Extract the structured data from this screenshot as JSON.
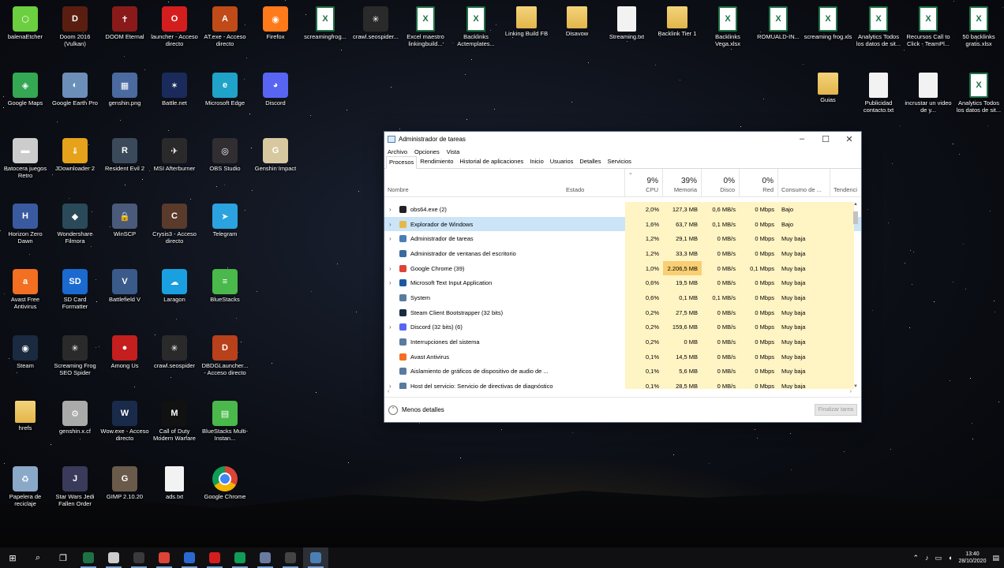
{
  "desktop_icons": [
    {
      "label": "balenaEtcher",
      "color": "#6bcf3f",
      "glyph": "⬡"
    },
    {
      "label": "Doom 2016 (Vulkan)",
      "color": "#5a1e10",
      "glyph": "D"
    },
    {
      "label": "DOOM Eternal",
      "color": "#8a1a1a",
      "glyph": "✝"
    },
    {
      "label": "launcher - Acceso directo",
      "color": "#d41e1e",
      "glyph": "O"
    },
    {
      "label": "AT.exe - Acceso directo",
      "color": "#c04a18",
      "glyph": "A"
    },
    {
      "label": "Firefox",
      "color": "#ff7a1a",
      "glyph": "◉"
    },
    {
      "label": "screamingfrog...",
      "type": "xl"
    },
    {
      "label": "crawl.seospider...",
      "color": "#2a2a2a",
      "glyph": "✳"
    },
    {
      "label": "Excel maestro linkingbuild...",
      "type": "xl"
    },
    {
      "label": "Backlinks Actemplates...",
      "type": "xl"
    },
    {
      "label": "Linking Build FB",
      "type": "folder"
    },
    {
      "label": "Disavow",
      "type": "folder"
    },
    {
      "label": "Streaming.txt",
      "type": "txt"
    },
    {
      "label": "Backlink Tier 1",
      "type": "folder"
    },
    {
      "label": "Backlinks Vega.xlsx",
      "type": "xl"
    },
    {
      "label": "ROMUALD-IN...",
      "type": "xl"
    },
    {
      "label": "screaming frog.xls",
      "type": "xl"
    },
    {
      "label": "Analytics Todos los datos de sit...",
      "type": "xl"
    },
    {
      "label": "Recursos Call to Click - TeamPl...",
      "type": "xl"
    },
    {
      "label": "50 backlinks gratis.xlsx",
      "type": "xl"
    },
    {
      "label": "Google Maps",
      "color": "#34a853",
      "glyph": "◈"
    },
    {
      "label": "Google Earth Pro",
      "color": "#6b8fb8",
      "glyph": "◐"
    },
    {
      "label": "genshin.png",
      "color": "#4a6aa0",
      "glyph": "▦"
    },
    {
      "label": "Battle.net",
      "color": "#1a2a5a",
      "glyph": "✶"
    },
    {
      "label": "Microsoft Edge",
      "color": "#1fa3c9",
      "glyph": "e"
    },
    {
      "label": "Discord",
      "color": "#5865f2",
      "glyph": "◕"
    },
    {
      "label": "Guias",
      "type": "folder"
    },
    {
      "label": "Publicidad contacto.txt",
      "type": "txt"
    },
    {
      "label": "incrustar un video de y...",
      "type": "txt"
    },
    {
      "label": "Analytics Todos los datos de sit...",
      "type": "xl"
    },
    {
      "label": "Batocera juegos Retro",
      "color": "#cccccc",
      "glyph": "▬"
    },
    {
      "label": "JDownloader 2",
      "color": "#e6a21a",
      "glyph": "⇓"
    },
    {
      "label": "Resident Evil 2",
      "color": "#3a4a5a",
      "glyph": "R"
    },
    {
      "label": "MSI Afterburner",
      "color": "#2a2a2a",
      "glyph": "✈"
    },
    {
      "label": "OBS Studio",
      "color": "#302e31",
      "glyph": "◎"
    },
    {
      "label": "Genshin Impact",
      "color": "#d8c8a0",
      "glyph": "G"
    },
    {
      "label": "Horizon Zero Dawn",
      "color": "#3a5aa0",
      "glyph": "H"
    },
    {
      "label": "Wondershare Filmora",
      "color": "#2a4a5a",
      "glyph": "◆"
    },
    {
      "label": "WinSCP",
      "color": "#4a5a7a",
      "glyph": "🔒"
    },
    {
      "label": "Crysis3 - Acceso directo",
      "color": "#5a3a2a",
      "glyph": "C"
    },
    {
      "label": "Telegram",
      "color": "#2aa3e0",
      "glyph": "➤"
    },
    {
      "label": "Avast Free Antivirus",
      "color": "#f36f21",
      "glyph": "a"
    },
    {
      "label": "SD Card Formatter",
      "color": "#1a6ad0",
      "glyph": "SD"
    },
    {
      "label": "Battlefield V",
      "color": "#3a5a8a",
      "glyph": "V"
    },
    {
      "label": "Laragon",
      "color": "#1aa0e0",
      "glyph": "☁"
    },
    {
      "label": "BlueStacks",
      "color": "#4ab84a",
      "glyph": "≡"
    },
    {
      "label": "Steam",
      "color": "#1a2a40",
      "glyph": "◉"
    },
    {
      "label": "Screaming Frog SEO Spider",
      "color": "#2a2a2a",
      "glyph": "✳"
    },
    {
      "label": "Among Us",
      "color": "#c41e1e",
      "glyph": "●"
    },
    {
      "label": "crawl.seospider",
      "color": "#2a2a2a",
      "glyph": "✳"
    },
    {
      "label": "DBDGLauncher... - Acceso directo",
      "color": "#b8401a",
      "glyph": "D"
    },
    {
      "label": "hrefs",
      "type": "folder"
    },
    {
      "label": "genshin.x.cf",
      "color": "#aaaaaa",
      "glyph": "⚙"
    },
    {
      "label": "Wow.exe - Acceso directo",
      "color": "#1a2a4a",
      "glyph": "W"
    },
    {
      "label": "Call of Duty Modern Warfare",
      "color": "#111111",
      "glyph": "M"
    },
    {
      "label": "BlueStacks Multi-Instan...",
      "color": "#4ab84a",
      "glyph": "▤"
    },
    {
      "label": "Papelera de reciclaje",
      "color": "#8aa8c8",
      "glyph": "♻"
    },
    {
      "label": "Star Wars Jedi Fallen Order",
      "color": "#3a3a5a",
      "glyph": "J"
    },
    {
      "label": "GIMP 2.10.20",
      "color": "#6a5a4a",
      "glyph": "G"
    },
    {
      "label": "ads.txt",
      "type": "txt"
    },
    {
      "label": "Google Chrome",
      "type": "chrome"
    }
  ],
  "task_manager": {
    "title": "Administrador de tareas",
    "menu": [
      "Archivo",
      "Opciones",
      "Vista"
    ],
    "tabs": [
      "Procesos",
      "Rendimiento",
      "Historial de aplicaciones",
      "Inicio",
      "Usuarios",
      "Detalles",
      "Servicios"
    ],
    "columns": {
      "name": "Nombre",
      "status": "Estado",
      "cpu": {
        "pct": "9%",
        "label": "CPU"
      },
      "mem": {
        "pct": "39%",
        "label": "Memoria"
      },
      "disk": {
        "pct": "0%",
        "label": "Disco"
      },
      "net": {
        "pct": "0%",
        "label": "Red"
      },
      "power": "Consumo de ...",
      "trend": "Tendenci"
    },
    "processes": [
      {
        "name": "obs64.exe (2)",
        "exp": "›",
        "icon": "#222222",
        "cpu": "2,0%",
        "mem": "127,3 MB",
        "disk": "0,6 MB/s",
        "net": "0 Mbps",
        "power": "Bajo"
      },
      {
        "name": "Explorador de Windows",
        "exp": "›",
        "icon": "#e6b84a",
        "cpu": "1,6%",
        "mem": "63,7 MB",
        "disk": "0,1 MB/s",
        "net": "0 Mbps",
        "power": "Bajo"
      },
      {
        "name": "Administrador de tareas",
        "exp": "›",
        "icon": "#4a7fb5",
        "cpu": "1,2%",
        "mem": "29,1 MB",
        "disk": "0 MB/s",
        "net": "0 Mbps",
        "power": "Muy baja"
      },
      {
        "name": "Administrador de ventanas del escritorio",
        "exp": "",
        "icon": "#3a6aa0",
        "cpu": "1,2%",
        "mem": "33,3 MB",
        "disk": "0 MB/s",
        "net": "0 Mbps",
        "power": "Muy baja"
      },
      {
        "name": "Google Chrome (39)",
        "exp": "›",
        "icon": "#db4437",
        "cpu": "1,0%",
        "mem": "2.206,5 MB",
        "disk": "0 MB/s",
        "net": "0,1 Mbps",
        "power": "Muy baja",
        "hot": true
      },
      {
        "name": "Microsoft Text Input Application",
        "exp": "›",
        "icon": "#1a5aa0",
        "cpu": "0,6%",
        "mem": "19,5 MB",
        "disk": "0 MB/s",
        "net": "0 Mbps",
        "power": "Muy baja"
      },
      {
        "name": "System",
        "exp": "",
        "icon": "#5a7aa0",
        "cpu": "0,6%",
        "mem": "0,1 MB",
        "disk": "0,1 MB/s",
        "net": "0 Mbps",
        "power": "Muy baja"
      },
      {
        "name": "Steam Client Bootstrapper (32 bits)",
        "exp": "",
        "icon": "#1a2a40",
        "cpu": "0,2%",
        "mem": "27,5 MB",
        "disk": "0 MB/s",
        "net": "0 Mbps",
        "power": "Muy baja"
      },
      {
        "name": "Discord (32 bits) (6)",
        "exp": "›",
        "icon": "#5865f2",
        "cpu": "0,2%",
        "mem": "159,6 MB",
        "disk": "0 MB/s",
        "net": "0 Mbps",
        "power": "Muy baja"
      },
      {
        "name": "Interrupciones del sistema",
        "exp": "",
        "icon": "#5a7aa0",
        "cpu": "0,2%",
        "mem": "0 MB",
        "disk": "0 MB/s",
        "net": "0 Mbps",
        "power": "Muy baja"
      },
      {
        "name": "Avast Antivirus",
        "exp": "",
        "icon": "#f36f21",
        "cpu": "0,1%",
        "mem": "14,5 MB",
        "disk": "0 MB/s",
        "net": "0 Mbps",
        "power": "Muy baja"
      },
      {
        "name": "Aislamiento de gráficos de dispositivo de audio de ...",
        "exp": "",
        "icon": "#5a7aa0",
        "cpu": "0,1%",
        "mem": "5,6 MB",
        "disk": "0 MB/s",
        "net": "0 Mbps",
        "power": "Muy baja"
      },
      {
        "name": "Host del servicio: Servicio de directivas de diagnóstico",
        "exp": "›",
        "icon": "#5a7aa0",
        "cpu": "0,1%",
        "mem": "28,5 MB",
        "disk": "0 MB/s",
        "net": "0 Mbps",
        "power": "Muy baja"
      }
    ],
    "footer": {
      "less_details": "Menos detalles",
      "end_task": "Finalizar tarea"
    }
  },
  "taskbar": {
    "items": [
      {
        "name": "start",
        "glyph": "⊞",
        "color": ""
      },
      {
        "name": "search",
        "glyph": "⌕",
        "color": ""
      },
      {
        "name": "task-view",
        "glyph": "❐",
        "color": ""
      },
      {
        "name": "excel",
        "glyph": "",
        "color": "#1e7145"
      },
      {
        "name": "store",
        "glyph": "",
        "color": "#cccccc"
      },
      {
        "name": "crawl",
        "glyph": "",
        "color": "#3a3a3a"
      },
      {
        "name": "chrome",
        "glyph": "",
        "color": "#db4437"
      },
      {
        "name": "remote",
        "glyph": "",
        "color": "#2a6ad0"
      },
      {
        "name": "opera",
        "glyph": "",
        "color": "#d41e1e"
      },
      {
        "name": "chrome-2",
        "glyph": "",
        "color": "#0f9d58"
      },
      {
        "name": "app",
        "glyph": "",
        "color": "#6a7aa0"
      },
      {
        "name": "obs",
        "glyph": "",
        "color": "#444444"
      },
      {
        "name": "task-manager",
        "glyph": "",
        "color": "#4a7fb5"
      }
    ],
    "time": "13:40",
    "date": "28/10/2020"
  }
}
